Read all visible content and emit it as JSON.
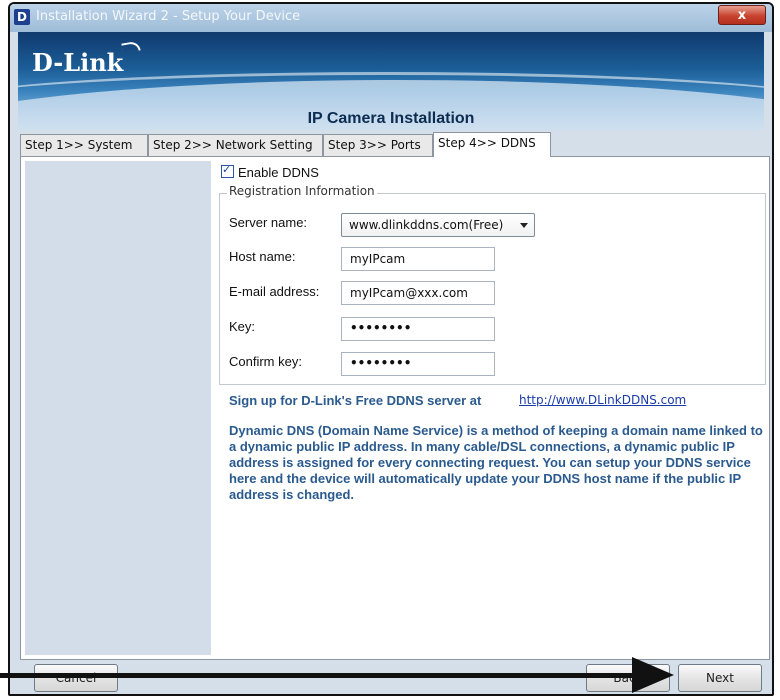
{
  "window": {
    "title": "Installation Wizard 2 - Setup Your Device",
    "app_icon": "D",
    "close_glyph": "x"
  },
  "banner": {
    "logo": "D-Link",
    "heading": "IP Camera Installation"
  },
  "tabs": [
    {
      "label": "Step 1>> System"
    },
    {
      "label": "Step 2>> Network Setting"
    },
    {
      "label": "Step 3>> Ports"
    },
    {
      "label": "Step 4>> DDNS",
      "active": true
    }
  ],
  "ddns": {
    "enable_label": "Enable DDNS",
    "enabled": true,
    "group_label": "Registration Information",
    "server_label": "Server name:",
    "server_value": "www.dlinkddns.com(Free)",
    "host_label": "Host name:",
    "host_value": "myIPcam",
    "email_label": "E-mail address:",
    "email_value": "myIPcam@xxx.com",
    "key_label": "Key:",
    "key_value": "••••••••",
    "confirm_label": "Confirm key:",
    "confirm_value": "••••••••"
  },
  "info": {
    "signup_text": "Sign up for D-Link's Free DDNS server at",
    "signup_link": "http://www.DLinkDDNS.com",
    "description": "Dynamic DNS (Domain Name Service) is a method of keeping a domain name linked to a dynamic public IP address. In many cable/DSL connections, a dynamic public IP address is assigned for every connecting request. You can setup your DDNS service here and the device will automatically update your DDNS host name if the public IP address is changed."
  },
  "buttons": {
    "cancel": "Cancel",
    "back": "Back",
    "next": "Next"
  },
  "icons": {
    "dropdown": "chevron-down-icon",
    "pointer": "arrow-right-icon"
  }
}
